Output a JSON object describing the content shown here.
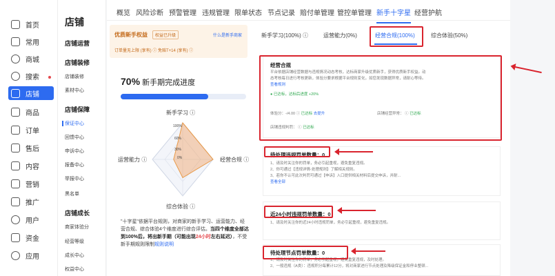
{
  "rail": {
    "items": [
      "首页",
      "常用",
      "商城",
      "搜索",
      "店铺",
      "商品",
      "订单",
      "售后",
      "内容",
      "营销",
      "推广",
      "用户",
      "资金",
      "应用"
    ],
    "active_index": 4
  },
  "submenu": {
    "title": "店铺",
    "groups": [
      {
        "head": "店铺运营",
        "items": []
      },
      {
        "head": "店铺装修",
        "items": [
          "店铺装修",
          "素材中心"
        ]
      },
      {
        "head": "店铺保障",
        "items": [
          "保证中心",
          "回馈中心",
          "申诉中心",
          "报备中心",
          "举报中心",
          "黑名单"
        ]
      },
      {
        "head": "店铺成长",
        "items": [
          "商家体验分",
          "经营等级",
          "成长中心",
          "权益中心"
        ]
      }
    ],
    "active_item": "保证中心"
  },
  "tabs": [
    "概览",
    "风险诊断",
    "预警管理",
    "违规管理",
    "限单状态",
    "节点记录",
    "赔付单管理",
    "管控单管理",
    "新手十字星",
    "经营护航"
  ],
  "active_tab": "新手十字星",
  "banner": {
    "title": "优质新手权益",
    "badge": "权益已升级",
    "link": "什么是新手商家",
    "line": "订单量无上限 (享有)  ⓘ  免赔T+14 (享有)  ⓘ"
  },
  "progress": {
    "percent_label": "70%",
    "title": "新手期完成进度",
    "value": 0.7
  },
  "radar": {
    "labels": [
      "新手学习 ⓘ",
      "经营合规 ⓘ",
      "综合体验 ⓘ",
      "运营能力 ⓘ"
    ],
    "ticks": [
      "100%",
      "60%",
      "30%",
      "0%"
    ],
    "values": [
      1.0,
      1.0,
      0.5,
      0.3
    ]
  },
  "description": {
    "part1": "\"十字星\"依据平台规则，对商家的新手学习、运营能力、经营合规、综合体验4个维度进行综合评估。",
    "bold": "当四个维度全部达到100%后，将出新手期（可能出现",
    "red": "24小时",
    "bold2": "左右延迟）",
    "part2": "，不受新手期规则限制",
    "link": "规则说明"
  },
  "subtabs": [
    "新手学习(100%)  ⓘ",
    "运营能力(0%)",
    "经营合规(100%)",
    "综合体验(50%)"
  ],
  "active_subtab": "经营合规(100%)",
  "compliance": {
    "title": "经营合规",
    "desc": "平台依据店铺经营数据与违规情况动态考核，达标商家升级优质新手，获得优质新手权益。动态考核每日进行考核更新，体验分要求根据平台规则变化，如您发现数据异常，请耐心等待。",
    "desc_link": "查看规则",
    "status": "已达标，达标后进度 +20%",
    "score_label": "体验分：-/4.00",
    "score_status": "已达标",
    "score_link": "去提升",
    "manage_label": "店铺经营异常：",
    "manage_status": "已达标",
    "judge_label": "店铺违规判罚：",
    "judge_status": "已达标"
  },
  "violation_pending": {
    "title": "待处理违规罚单数量：",
    "count": "0",
    "lines": [
      "1、请及时关注你的罚单，务必引起重视，避免重复违规。",
      "2、你可通过【违规详情-处理规则】了解相关规则。",
      "3、若你不认可此次判罚可通过【申诉】入口提供相关材料后提交申诉，并耐..."
    ],
    "link": "查看全部"
  },
  "violation_24h": {
    "title": "近24小时违规罚单数量：",
    "count": "0",
    "lines": [
      "1、请及时关注你的近24小时违规罚单，务必引起重视，避免重复违规。"
    ]
  },
  "node_pending": {
    "title": "待处理节点罚单数量：",
    "count": "0",
    "lines": [
      "1、请及时关注你的罚单，务必引起重视，避免重复违规，及时处理。",
      "2、一般违规（A类）：违规积分每累计12分，将对商家进行节点处理及降级保证金和停业整顿..."
    ]
  }
}
